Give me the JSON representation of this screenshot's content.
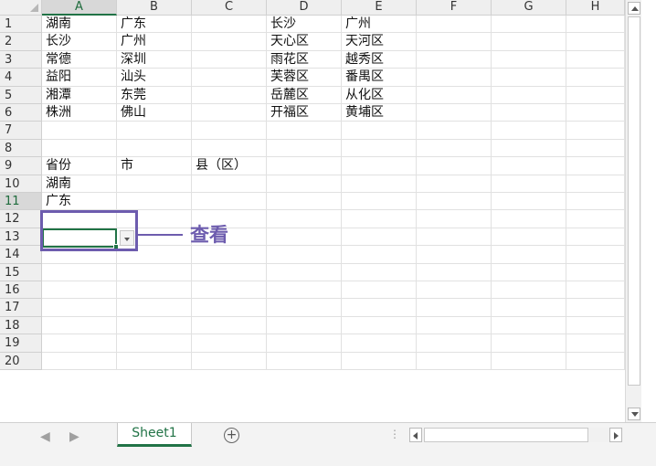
{
  "columns": [
    "A",
    "B",
    "C",
    "D",
    "E",
    "F",
    "G",
    "H"
  ],
  "rows": [
    "1",
    "2",
    "3",
    "4",
    "5",
    "6",
    "7",
    "8",
    "9",
    "10",
    "11",
    "12",
    "13",
    "14",
    "15",
    "16",
    "17",
    "18",
    "19",
    "20"
  ],
  "cells": {
    "A1": "湖南",
    "B1": "广东",
    "D1": "长沙",
    "E1": "广州",
    "A2": "长沙",
    "B2": "广州",
    "D2": "天心区",
    "E2": "天河区",
    "A3": "常德",
    "B3": "深圳",
    "D3": "雨花区",
    "E3": "越秀区",
    "A4": "益阳",
    "B4": "汕头",
    "D4": "芙蓉区",
    "E4": "番禺区",
    "A5": "湘潭",
    "B5": "东莞",
    "D5": "岳麓区",
    "E5": "从化区",
    "A6": "株洲",
    "B6": "佛山",
    "D6": "开福区",
    "E6": "黄埔区",
    "A9": "省份",
    "B9": "市",
    "C9": "县（区）",
    "A10": "湖南",
    "A11": "广东"
  },
  "active_cell": "A11",
  "annotation": {
    "label": "查看",
    "color": "#6d5cae"
  },
  "sheet_tab": {
    "label": "Sheet1"
  },
  "add_sheet_symbol": "+",
  "split_dots": "⋮",
  "nav": {
    "prev": "◀",
    "next": "▶"
  },
  "colors": {
    "accent": "#217346",
    "header_bg": "#efefef",
    "grid": "#e1e1e1"
  }
}
